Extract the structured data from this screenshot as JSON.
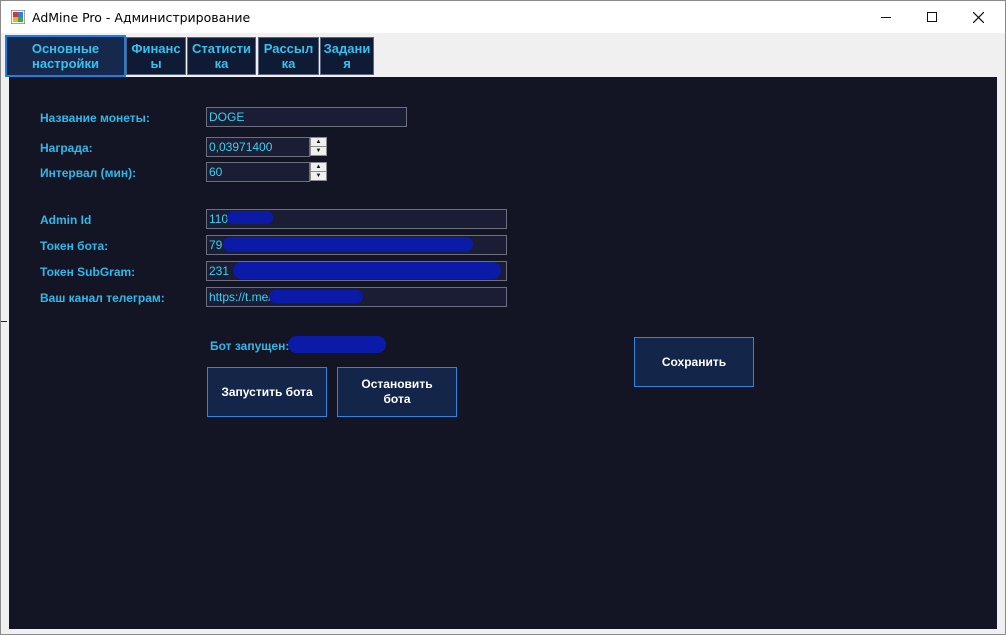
{
  "window": {
    "title": "AdMine Pro - Администрирование"
  },
  "tabs": [
    {
      "label": "Основные\nнастройки",
      "active": true
    },
    {
      "label": "Финанс\nы",
      "active": false
    },
    {
      "label": "Статисти\nка",
      "active": false
    },
    {
      "label": "Рассыл\nка",
      "active": false
    },
    {
      "label": "Задани\nя",
      "active": false
    }
  ],
  "form": {
    "coin_name_label": "Название монеты:",
    "coin_name_value": "DOGE",
    "reward_label": "Награда:",
    "reward_value": "0,03971400",
    "interval_label": "Интервал (мин):",
    "interval_value": "60",
    "admin_id_label": "Admin Id",
    "admin_id_value": "110",
    "bot_token_label": "Токен бота:",
    "bot_token_value": "79",
    "subgram_token_label": "Токен SubGram:",
    "subgram_token_value": "231",
    "channel_label": "Ваш канал телеграм:",
    "channel_value": "https://t.me/"
  },
  "status": {
    "bot_running_label": "Бот запущен:"
  },
  "buttons": {
    "start": "Запустить бота",
    "stop": "Остановить\nбота",
    "save": "Сохранить"
  },
  "colors": {
    "panel_bg": "#141524",
    "accent_text": "#2fb8ea",
    "button_border": "#2d86e0",
    "redaction": "#0c1aa8"
  }
}
